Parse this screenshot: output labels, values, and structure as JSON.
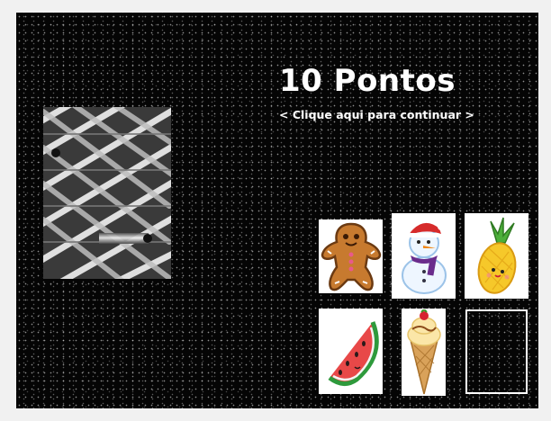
{
  "game": {
    "score_text": "10 Pontos",
    "continue_text": "< Clique aqui para continuar >"
  },
  "cards": [
    {
      "item": "gingerbread-man"
    },
    {
      "item": "snowman"
    },
    {
      "item": "pineapple"
    },
    {
      "item": "watermelon-slice"
    },
    {
      "item": "ice-cream-cone"
    },
    {
      "item": "empty-slot"
    }
  ],
  "colors": {
    "background": "#050505",
    "text": "#ffffff",
    "card_bg": "#ffffff"
  }
}
